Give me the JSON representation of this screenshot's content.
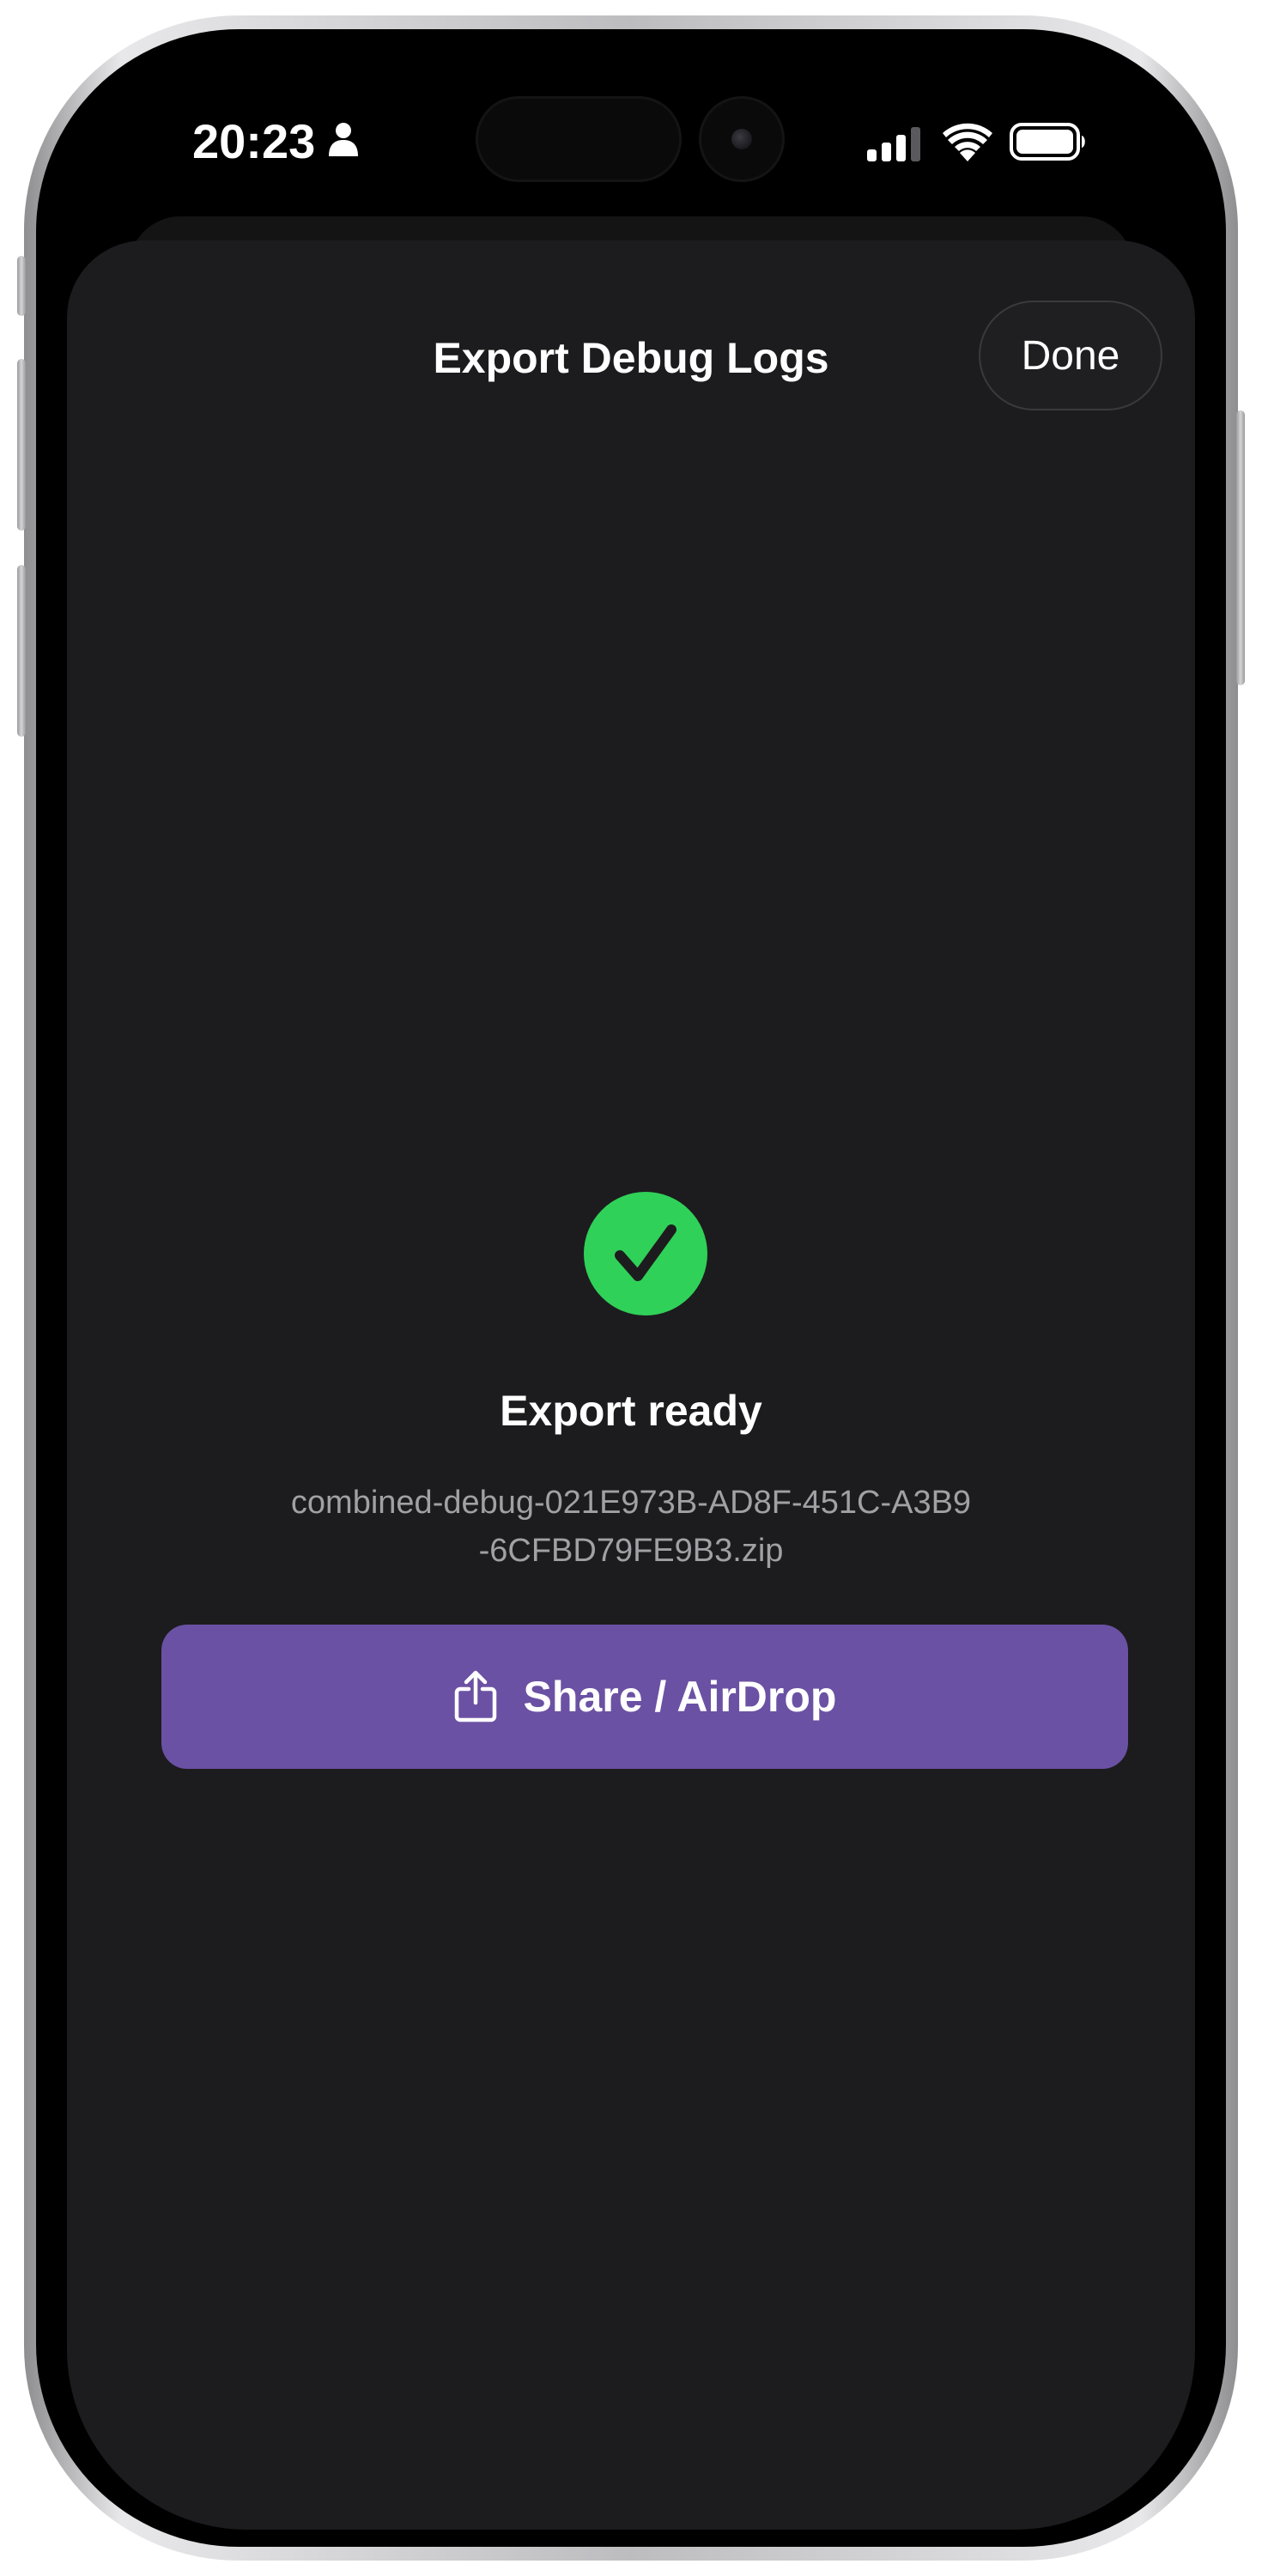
{
  "status_bar": {
    "time": "20:23",
    "person_icon": "person-icon",
    "signal_icon": "cellular-signal-icon",
    "wifi_icon": "wifi-icon",
    "battery_icon": "battery-icon"
  },
  "sheet": {
    "title": "Export Debug Logs",
    "done_label": "Done"
  },
  "result": {
    "status_icon": "checkmark-circle-icon",
    "status_color": "#30d158",
    "title": "Export ready",
    "file_name": "combined-debug-021E973B-AD8F-451C-A3B9-6CFBD79FE9B3.zip"
  },
  "share": {
    "label": "Share / AirDrop",
    "icon": "share-icon",
    "accent_color": "#6b51a3"
  }
}
